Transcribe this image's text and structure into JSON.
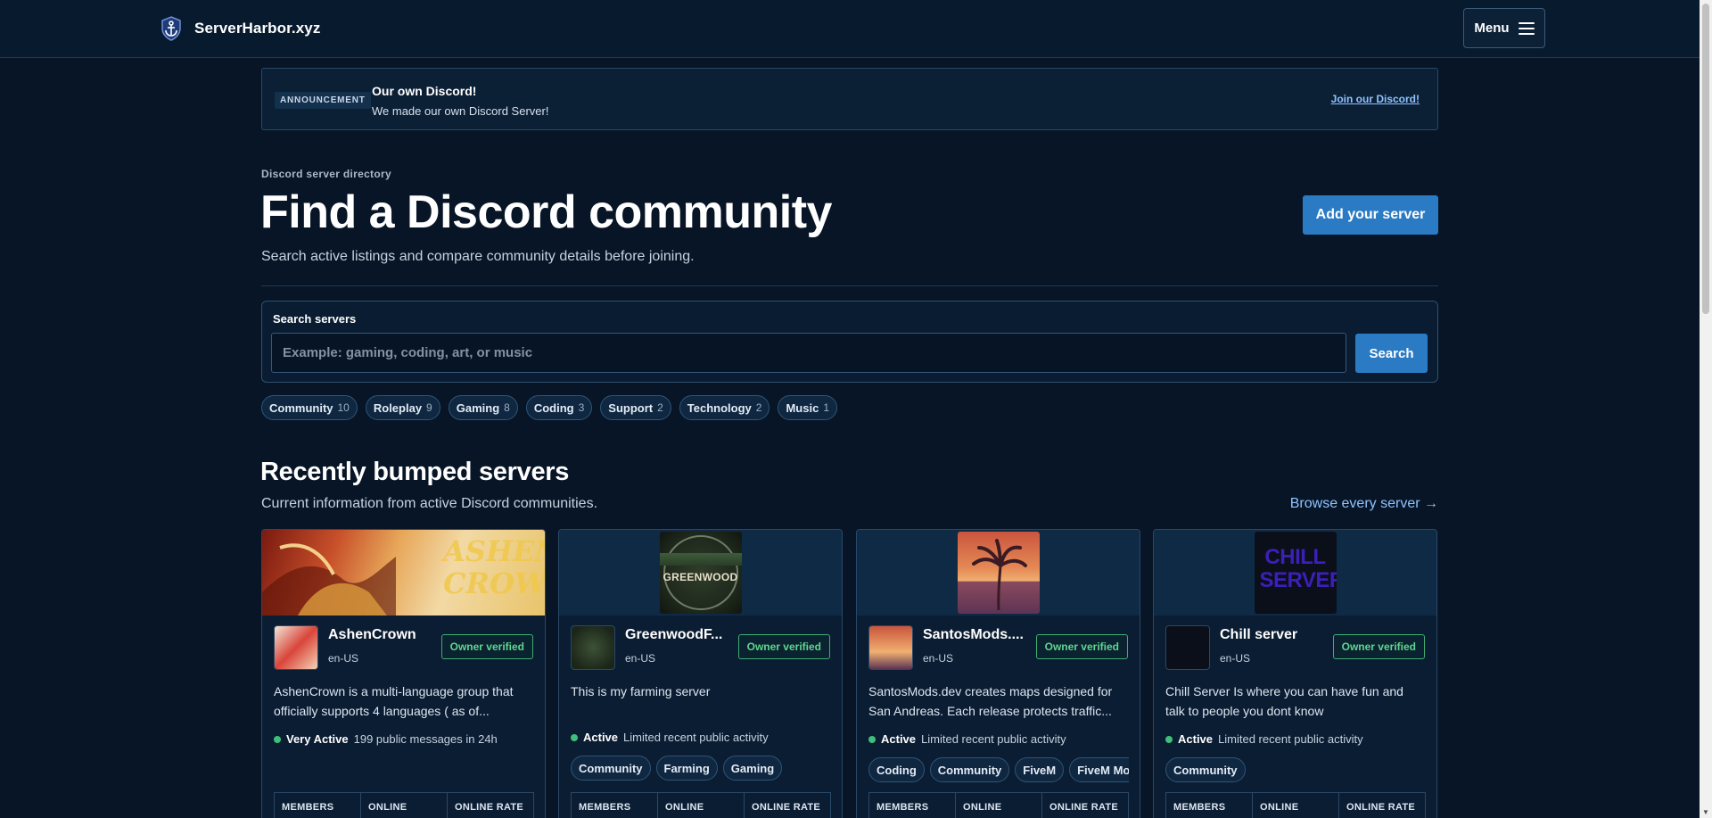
{
  "header": {
    "brand": "ServerHarbor.xyz",
    "logo_icon": "anchor-shield-icon",
    "menu_label": "Menu"
  },
  "announcement": {
    "tag": "ANNOUNCEMENT",
    "title": "Our own Discord!",
    "text": "We made our own Discord Server!",
    "link": "Join our Discord!"
  },
  "hero": {
    "eyebrow": "Discord server directory",
    "title": "Find a Discord community",
    "subtitle": "Search active listings and compare community details before joining.",
    "add_button": "Add your server"
  },
  "search": {
    "label": "Search servers",
    "placeholder": "Example: gaming, coding, art, or music",
    "button": "Search"
  },
  "tags": [
    {
      "name": "Community",
      "count": "10"
    },
    {
      "name": "Roleplay",
      "count": "9"
    },
    {
      "name": "Gaming",
      "count": "8"
    },
    {
      "name": "Coding",
      "count": "3"
    },
    {
      "name": "Support",
      "count": "2"
    },
    {
      "name": "Technology",
      "count": "2"
    },
    {
      "name": "Music",
      "count": "1"
    }
  ],
  "section": {
    "title": "Recently bumped servers",
    "subtitle": "Current information from active Discord communities.",
    "browse_link": "Browse every server →"
  },
  "cards": [
    {
      "name": "AshenCrown",
      "lang": "en-US",
      "verified": "Owner verified",
      "desc": "AshenCrown is a multi-language group that officially supports 4 languages ( as of...",
      "activity_level": "Very Active",
      "activity_text": "199 public messages in 24h",
      "tags": [],
      "banner_text": "ASHEN CROWN",
      "stats": [
        "MEMBERS",
        "ONLINE",
        "ONLINE RATE"
      ]
    },
    {
      "name": "GreenwoodF...",
      "lang": "en-US",
      "verified": "Owner verified",
      "desc": "This is my farming server",
      "activity_level": "Active",
      "activity_text": "Limited recent public activity",
      "tags": [
        "Community",
        "Farming",
        "Gaming"
      ],
      "banner_text": "GREENWOOD",
      "stats": [
        "MEMBERS",
        "ONLINE",
        "ONLINE RATE"
      ]
    },
    {
      "name": "SantosMods....",
      "lang": "en-US",
      "verified": "Owner verified",
      "desc": "SantosMods.dev creates maps designed for San Andreas. Each release protects traffic...",
      "activity_level": "Active",
      "activity_text": "Limited recent public activity",
      "tags": [
        "Coding",
        "Community",
        "FiveM",
        "FiveM Mod"
      ],
      "banner_text": "",
      "stats": [
        "MEMBERS",
        "ONLINE",
        "ONLINE RATE"
      ]
    },
    {
      "name": "Chill server",
      "lang": "en-US",
      "verified": "Owner verified",
      "desc": "Chill Server Is where you can have fun and talk to people you dont know",
      "activity_level": "Active",
      "activity_text": "Limited recent public activity",
      "tags": [
        "Community"
      ],
      "banner_text": "CHILL SERVER",
      "stats": [
        "MEMBERS",
        "ONLINE",
        "ONLINE RATE"
      ]
    }
  ]
}
